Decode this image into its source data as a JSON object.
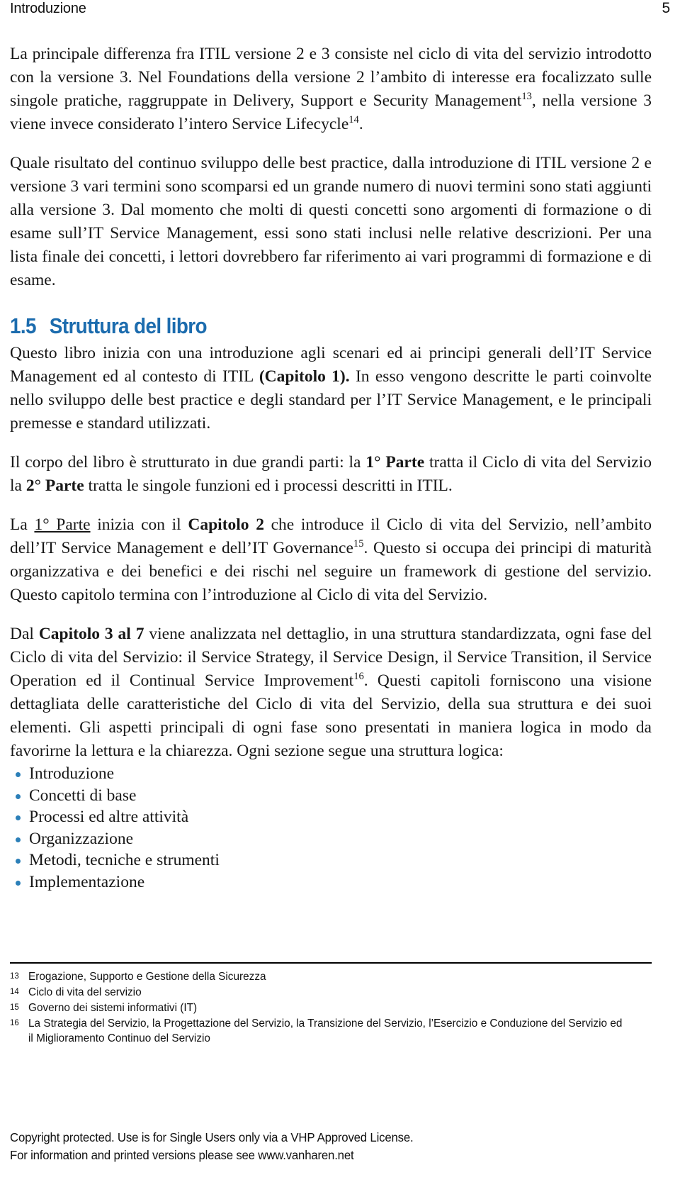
{
  "colors": {
    "heading_blue": "#1C6CAE",
    "bullet_blue": "#2B7FB8",
    "text": "#171717",
    "rule": "#000000"
  },
  "running_head": {
    "chapter_title": "Introduzione",
    "page_number": "5"
  },
  "paragraphs": {
    "p1_part1": "La principale differenza fra ITIL versione 2 e 3 consiste nel ciclo di vita del servizio introdotto con la versione 3. Nel Foundations della versione 2 l’ambito di interesse era focalizzato sulle singole pratiche, raggruppate in Delivery, Support e Security Management",
    "p1_sup_a": "13",
    "p1_part2": ", nella versione 3 viene invece considerato l’intero Service Lifecycle",
    "p1_sup_b": "14",
    "p1_part3": ".",
    "p2": "Quale risultato del continuo sviluppo delle best practice, dalla introduzione di ITIL versione 2 e versione 3 vari termini sono scomparsi ed un grande numero di nuovi termini sono stati aggiunti alla versione 3. Dal momento che molti di questi concetti sono argomenti di formazione o di esame sull’IT Service Management, essi sono stati inclusi nelle relative descrizioni. Per una lista finale dei concetti, i lettori dovrebbero far riferimento ai vari programmi di formazione e di esame.",
    "p3_part1": "Questo libro inizia con una introduzione agli scenari ed ai principi generali dell’IT Service Management ed al contesto di ITIL ",
    "p3_bold": "(Capitolo 1).",
    "p3_part2": " In esso vengono descritte le parti coinvolte nello sviluppo delle best practice e degli standard per l’IT Service Management, e le principali premesse e standard utilizzati.",
    "p4_part1": "Il corpo del libro è strutturato in due grandi parti: la ",
    "p4_bold1": "1° Parte",
    "p4_part2": " tratta il Ciclo di vita del Servizio la ",
    "p4_bold2": "2° Parte",
    "p4_part3": " tratta le singole funzioni ed i processi descritti in ITIL.",
    "p5_part1": "La ",
    "p5_underline": "1° Parte",
    "p5_part2": " inizia con il ",
    "p5_bold": "Capitolo 2",
    "p5_part3": " che introduce il Ciclo di vita del Servizio, nell’ambito dell’IT Service Management e dell’IT Governance",
    "p5_sup": "15",
    "p5_part4": ". Questo si occupa dei principi di maturità organizzativa e dei benefici e dei rischi nel seguire un framework di gestione del servizio. Questo capitolo termina con l’introduzione al Ciclo di vita del Servizio.",
    "p6_part1": "Dal ",
    "p6_bold": "Capitolo 3 al 7",
    "p6_part2": " viene analizzata nel dettaglio, in una struttura standardizzata, ogni fase del Ciclo di vita del Servizio: il Service Strategy, il Service Design, il Service Transition, il Service Operation ed il Continual Service Improvement",
    "p6_sup": "16",
    "p6_part3": ". Questi capitoli forniscono una visione dettagliata delle caratteristiche del Ciclo di vita del Servizio, della sua struttura e dei suoi elementi. Gli aspetti principali di ogni fase sono presentati in maniera logica in modo da favorirne la lettura e la chiarezza. Ogni sezione segue una struttura logica:"
  },
  "section_heading": {
    "number": "1.5",
    "title": "Struttura del libro"
  },
  "bullet_list": [
    "Introduzione",
    "Concetti di base",
    "Processi ed altre attività",
    "Organizzazione",
    "Metodi, tecniche e strumenti",
    "Implementazione"
  ],
  "footnotes": [
    {
      "mark": "13",
      "text": "Erogazione, Supporto e Gestione della Sicurezza"
    },
    {
      "mark": "14",
      "text": "Ciclo di vita del servizio"
    },
    {
      "mark": "15",
      "text": "Governo dei sistemi informativi (IT)"
    },
    {
      "mark": "16",
      "text": "La Strategia del Servizio, la Progettazione del Servizio, la Transizione del Servizio, l’Esercizio e Conduzione del Servizio ed il Miglioramento Continuo del Servizio"
    }
  ],
  "copyright": {
    "line1": "Copyright protected. Use is for Single Users only via a VHP Approved License.",
    "line2": "For information and printed versions please see www.vanharen.net"
  }
}
